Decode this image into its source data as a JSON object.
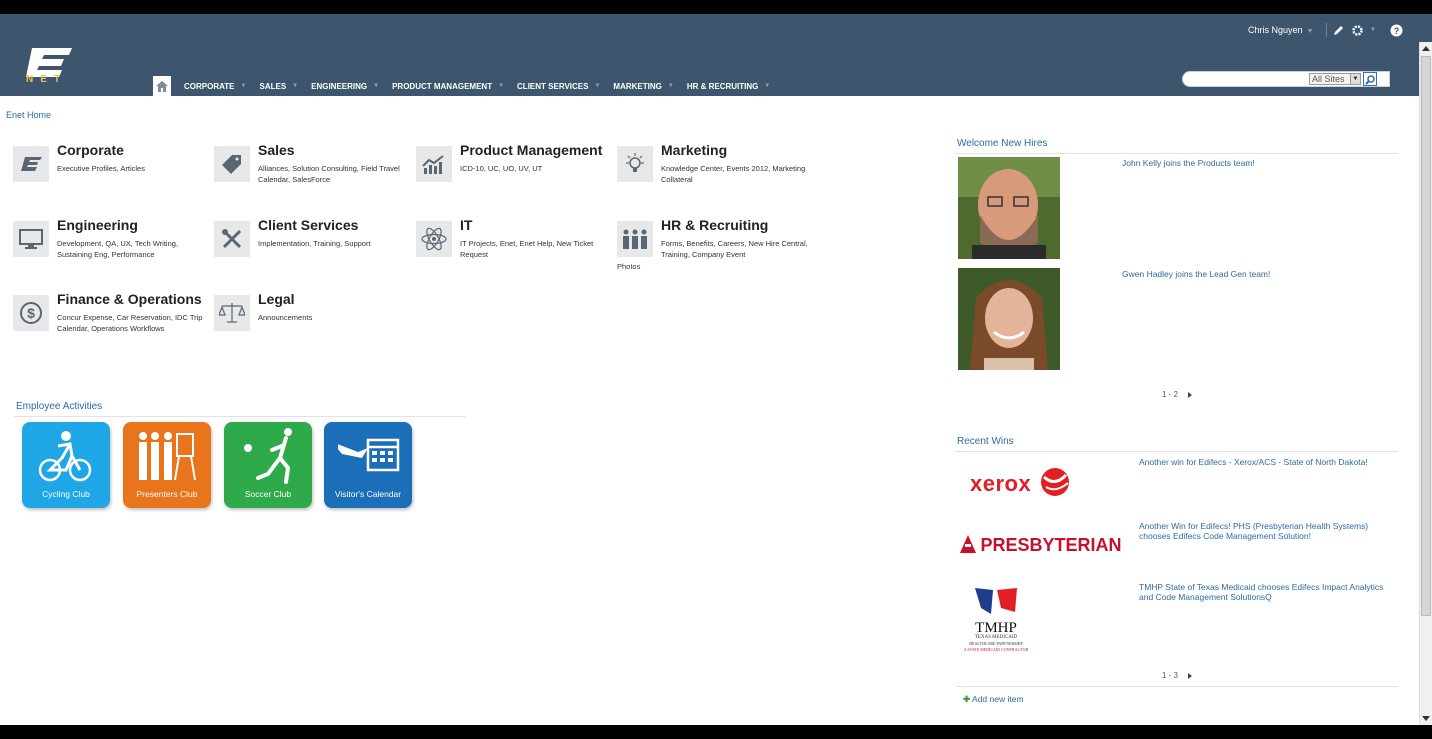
{
  "header": {
    "logo_text": "NET",
    "user_name": "Chris Nguyen",
    "nav_items": [
      "CORPORATE",
      "SALES",
      "ENGINEERING",
      "PRODUCT MANAGEMENT",
      "CLIENT SERVICES",
      "MARKETING",
      "HR & RECRUITING"
    ],
    "search_scope": "All Sites",
    "search_placeholder": ""
  },
  "breadcrumb": "Enet Home",
  "sites": [
    {
      "title": "Corporate",
      "desc": "Executive Profiles, Articles",
      "icon": "enet-logo-icon"
    },
    {
      "title": "Sales",
      "desc": "Alliances, Solution Consulting, Field Travel Calendar, SalesForce",
      "icon": "tag-icon"
    },
    {
      "title": "Product Management",
      "desc": "ICD-10, UC, UO, UV, UT",
      "icon": "growth-chart-icon"
    },
    {
      "title": "Marketing",
      "desc": "Knowledge Center, Events 2012, Marketing Collateral",
      "icon": "lightbulb-icon"
    },
    {
      "title": "Engineering",
      "desc": "Development, QA, UX, Tech Writing, Sustaining Eng, Performance",
      "icon": "monitor-icon"
    },
    {
      "title": "Client Services",
      "desc": "Implementation, Training, Support",
      "icon": "tools-icon"
    },
    {
      "title": "IT",
      "desc": "IT Projects, Enet, Enet Help, New Ticket Request",
      "icon": "atom-icon"
    },
    {
      "title": "HR & Recruiting",
      "desc": "Forms, Benefits, Careers, New Hire Central, Training, Company Event",
      "icon": "people-icon"
    },
    {
      "title": "Finance & Operations",
      "desc": "Concur Expense, Car Reservation, IDC Trip Calendar, Operations Workflows",
      "icon": "dollar-icon"
    },
    {
      "title": "Legal",
      "desc": "Announcements",
      "icon": "scales-icon"
    }
  ],
  "hr_overflow": "Photos",
  "activities": {
    "title": "Employee Activities",
    "clubs": [
      {
        "label": "Cycling Club",
        "color": "#1ea6e6"
      },
      {
        "label": "Presenters Club",
        "color": "#e8741c"
      },
      {
        "label": "Soccer Club",
        "color": "#2eaa4a"
      },
      {
        "label": "Visitor's Calendar",
        "color": "#1a6fb8"
      }
    ]
  },
  "new_hires": {
    "title": "Welcome New Hires",
    "items": [
      "John Kelly joins the Products team!",
      "Gwen Hadley joins the Lead Gen team!"
    ],
    "pager": "1 - 2"
  },
  "recent_wins": {
    "title": "Recent Wins",
    "items": [
      {
        "logo": "xerox",
        "text": "Another win for Edifecs - Xerox/ACS - State of North Dakota!"
      },
      {
        "logo": "PRESBYTERIAN",
        "text": "Another Win for Edifecs! PHS (Presbyterian Health Systems) chooses Edifecs Code Management Solution!"
      },
      {
        "logo": "TMHP",
        "text": "TMHP State of Texas Medicaid chooses Edifecs Impact Analytics and Code Management SolutionsQ"
      }
    ],
    "tmhp_sub": "TEXAS MEDICAID",
    "tmhp_sub2": "HEALTHCARE PARTNERSHIP",
    "tmhp_sub3": "A STATE MEDICAID CONTRACTOR",
    "pager": "1 - 3",
    "add_new": "Add new item"
  },
  "colors": {
    "header": "#3d566d",
    "link": "#2d6ba3"
  }
}
